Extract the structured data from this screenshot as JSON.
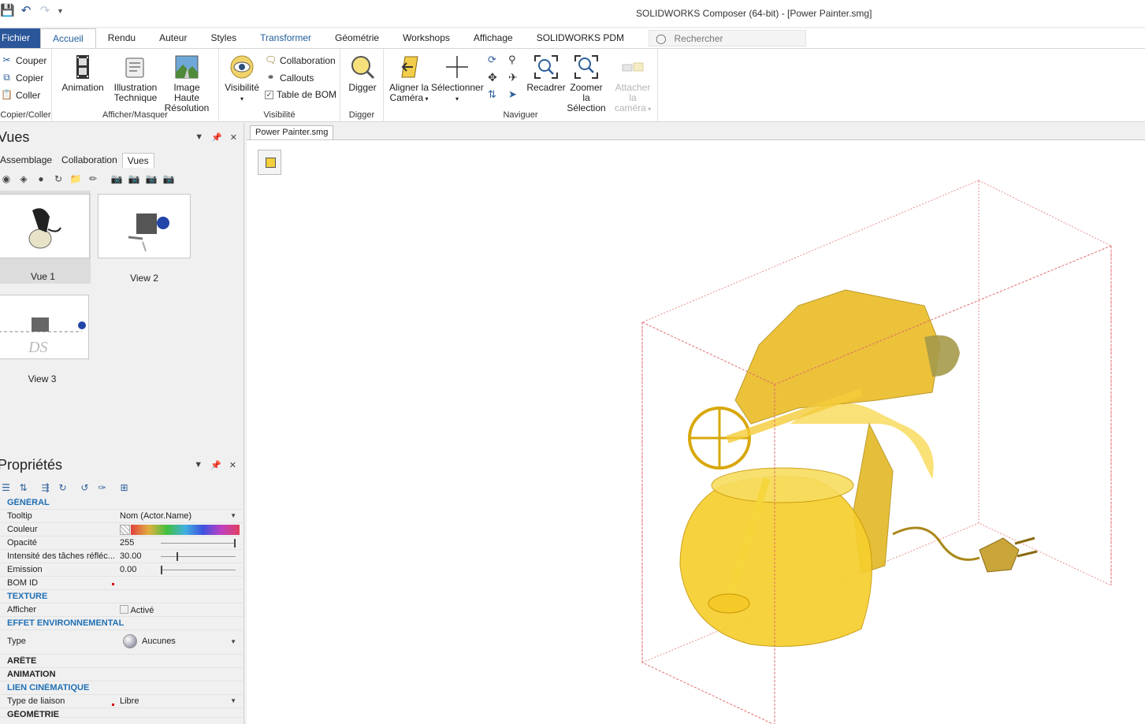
{
  "window": {
    "title": "SOLIDWORKS Composer (64-bit) - [Power Painter.smg]"
  },
  "tabs": [
    {
      "label": "Fichier"
    },
    {
      "label": "Accueil"
    },
    {
      "label": "Rendu"
    },
    {
      "label": "Auteur"
    },
    {
      "label": "Styles"
    },
    {
      "label": "Transformer"
    },
    {
      "label": "Géométrie"
    },
    {
      "label": "Workshops"
    },
    {
      "label": "Affichage"
    },
    {
      "label": "SOLIDWORKS PDM"
    }
  ],
  "search": {
    "placeholder": "Rechercher"
  },
  "ribbon": {
    "clipboard": {
      "cut": "Couper",
      "copy": "Copier",
      "paste": "Coller",
      "group": "Copier/Coller"
    },
    "show_hide": {
      "animation": "Animation",
      "tech_illus_1": "Illustration",
      "tech_illus_2": "Technique",
      "hires_1": "Image Haute",
      "hires_2": "Résolution",
      "group": "Afficher/Masquer"
    },
    "visibility": {
      "visibility": "Visibilité",
      "collaboration": "Collaboration",
      "callouts": "Callouts",
      "bom_table": "Table de BOM",
      "group": "Visibilité"
    },
    "digger": {
      "digger": "Digger",
      "group": "Digger"
    },
    "navigate": {
      "align_1": "Aligner la",
      "align_2": "Caméra",
      "select": "Sélectionner",
      "reframe": "Recadrer",
      "zoom_1": "Zoomer la",
      "zoom_2": "Sélection",
      "attach_1": "Attacher la",
      "attach_2": "caméra",
      "group": "Naviguer"
    }
  },
  "views_panel": {
    "title": "Vues",
    "tabs": [
      "Assemblage",
      "Collaboration",
      "Vues"
    ],
    "views": [
      {
        "label": "Vue 1"
      },
      {
        "label": "View 2"
      },
      {
        "label": "View 3"
      }
    ]
  },
  "properties_panel": {
    "title": "Propriétés",
    "sections": {
      "general": "GÉNÉRAL",
      "texture": "TEXTURE",
      "env": "EFFET ENVIRONNEMENTAL",
      "edge": "ARÊTE",
      "animation": "ANIMATION",
      "kin": "LIEN CINÉMATIQUE",
      "geometry": "GÉOMÉTRIE"
    },
    "rows": {
      "tooltip_name": "Tooltip",
      "tooltip_val": "Nom (Actor.Name)",
      "color_name": "Couleur",
      "opacity_name": "Opacité",
      "opacity_val": "255",
      "spec_name": "Intensité des tâches réfléc...",
      "spec_val": "30.00",
      "emission_name": "Emission",
      "emission_val": "0.00",
      "bomid_name": "BOM ID",
      "show_name": "Afficher",
      "show_val": "Activé",
      "type_name": "Type",
      "type_val": "Aucunes",
      "link_name": "Type de liaison",
      "link_val": "Libre"
    },
    "sliders": {
      "opacity": 1.0,
      "specular": 0.22,
      "emission": 0.0
    }
  },
  "document": {
    "tab": "Power Painter.smg"
  },
  "colors": {
    "accent": "#2b579a",
    "model_yellow": "#f2c21b",
    "bbox": "#e06a6a"
  }
}
